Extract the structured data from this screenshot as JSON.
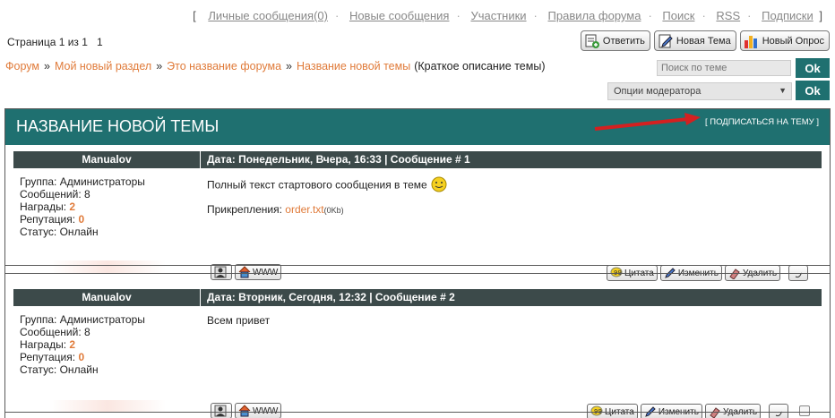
{
  "topnav": {
    "open": "[",
    "close": "]",
    "links": [
      "Личные сообщения(0)",
      "Новые сообщения",
      "Участники",
      "Правила форума",
      "Поиск",
      "RSS",
      "Подписки"
    ]
  },
  "pageinfo": {
    "text": "Страница 1 из 1",
    "num": "1"
  },
  "buttons": {
    "reply": "Ответить",
    "newtopic": "Новая Тема",
    "newpoll": "Новый Опрос"
  },
  "breadcrumb": {
    "items": [
      "Форум",
      "Мой новый раздел",
      "Это название форума",
      "Название новой темы"
    ],
    "sep": "»",
    "desc": "(Краткое описание темы)"
  },
  "search": {
    "placeholder": "Поиск по теме"
  },
  "moderator": {
    "label": "Опции модератора"
  },
  "ok_label": "Ok",
  "topic": {
    "title": "НАЗВАНИЕ НОВОЙ ТЕМЫ",
    "subscribe": "[ ПОДПИСАТЬСЯ НА ТЕМУ ]"
  },
  "posts": [
    {
      "author": "Manualov",
      "meta": "Дата: Понедельник, Вчера, 16:33 | Сообщение # 1",
      "group": "Группа: Администраторы",
      "messages": "Сообщений: 8",
      "awards_label": "Награды:",
      "awards": "2",
      "rep_label": "Репутация:",
      "rep": "0",
      "status": "Статус: Онлайн",
      "text": "Полный текст стартового сообщения в теме",
      "attach_label": "Прикрепления:",
      "attach_file": "order.txt",
      "attach_size": "(0Kb)"
    },
    {
      "author": "Manualov",
      "meta": "Дата: Вторник, Сегодня, 12:32 | Сообщение # 2",
      "group": "Группа: Администраторы",
      "messages": "Сообщений: 8",
      "awards_label": "Награды:",
      "awards": "2",
      "rep_label": "Репутация:",
      "rep": "0",
      "status": "Статус: Онлайн",
      "text": "Всем привет"
    }
  ],
  "postbtns": {
    "www": "WWW",
    "quote": "Цитата",
    "edit": "Изменить",
    "delete": "Удалить"
  },
  "colors": {
    "header_bg": "#1f7070",
    "post_head_bg": "#3c4a4a",
    "link": "#e07b3a",
    "arrow": "#d42020"
  }
}
